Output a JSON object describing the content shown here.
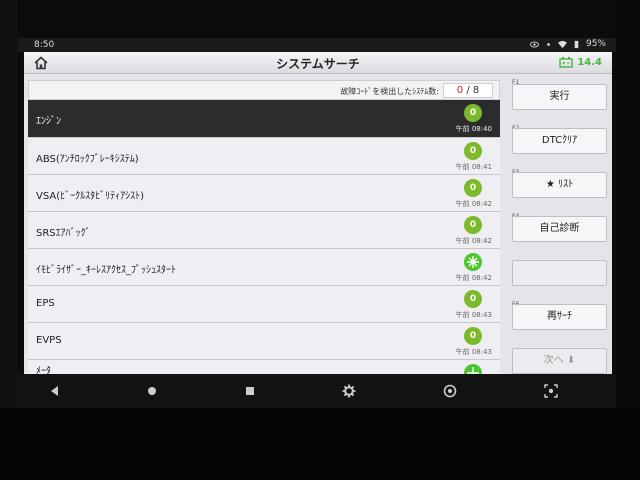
{
  "status_bar": {
    "time": "8:50",
    "battery": "95%"
  },
  "header": {
    "title": "システムサーチ",
    "vehicle_battery": "14.4"
  },
  "count_bar": {
    "label": "故障ｺｰﾄﾞを検出したｼｽﾃﾑ数:",
    "found": "0",
    "separator": "/",
    "total": "8"
  },
  "systems": [
    {
      "name": "ｴﾝｼﾞﾝ",
      "badge": "0",
      "time": "午前 08:40",
      "selected": true
    },
    {
      "name": "ABS(ｱﾝﾁﾛｯｸﾌﾞﾚｰｷｼｽﾃﾑ)",
      "badge": "0",
      "time": "午前 08:41"
    },
    {
      "name": "VSA(ﾋﾞｰｸﾙｽﾀﾋﾞﾘﾃｨｱｼｽﾄ)",
      "badge": "0",
      "time": "午前 08:42"
    },
    {
      "name": "SRSｴｱﾊﾞｯｸﾞ",
      "badge": "0",
      "time": "午前 08:42"
    },
    {
      "name": "ｲﾓﾋﾞﾗｲｻﾞｰ_ｷｰﾚｽｱｸｾｽ_ﾌﾟｯｼｭｽﾀｰﾄ",
      "badge": "",
      "time": "午前 08:42",
      "special": true
    },
    {
      "name": "EPS",
      "badge": "0",
      "time": "午前 08:43"
    },
    {
      "name": "EVPS",
      "badge": "0",
      "time": "午前 08:43"
    },
    {
      "name": "ﾒｰﾀ",
      "badge": "",
      "time": "",
      "special": true
    }
  ],
  "function_keys": {
    "f1": {
      "key": "F1",
      "label": "実行"
    },
    "f2": {
      "key": "F2",
      "label": "DTCｸﾘｱ"
    },
    "f3": {
      "key": "F3",
      "label": "★ ﾘｽﾄ"
    },
    "f4": {
      "key": "F4",
      "label": "自己診断"
    },
    "f5": {
      "key": "",
      "label": ""
    },
    "f6": {
      "key": "F6",
      "label": "再ｻｰﾁ"
    },
    "next": {
      "key": "",
      "label": "次へ ⬇"
    }
  },
  "colors": {
    "ok_badge": "#7cb92b",
    "accent_green": "#47b549",
    "selected_row": "#2c2c2e",
    "count_red": "#d52020"
  }
}
